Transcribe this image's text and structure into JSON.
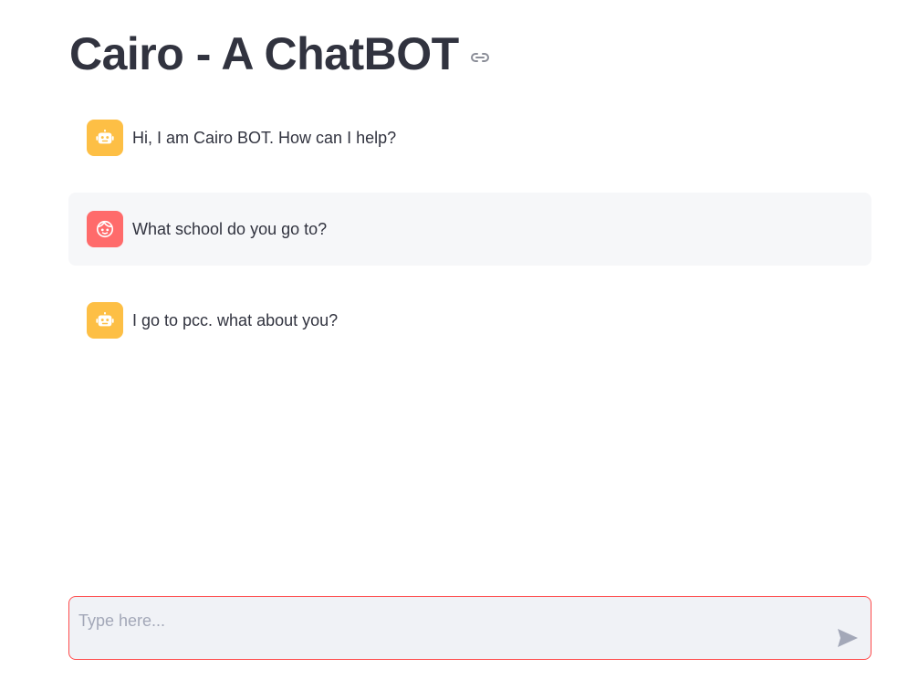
{
  "header": {
    "title": "Cairo - A ChatBOT",
    "link_icon": "link-icon"
  },
  "messages": [
    {
      "role": "assistant",
      "avatar_icon": "robot-icon",
      "text": "Hi, I am Cairo BOT. How can I help?"
    },
    {
      "role": "user",
      "avatar_icon": "smiley-icon",
      "text": "What school do you go to?"
    },
    {
      "role": "assistant",
      "avatar_icon": "robot-icon",
      "text": "I go to pcc. what about you?"
    }
  ],
  "chat_input": {
    "placeholder": "Type here...",
    "value": "",
    "send_icon": "send-icon"
  },
  "colors": {
    "bot_avatar": "#fdbf45",
    "user_avatar": "#ff6b6b",
    "input_border": "#ff4b4b",
    "user_bubble": "#f6f7f9"
  }
}
